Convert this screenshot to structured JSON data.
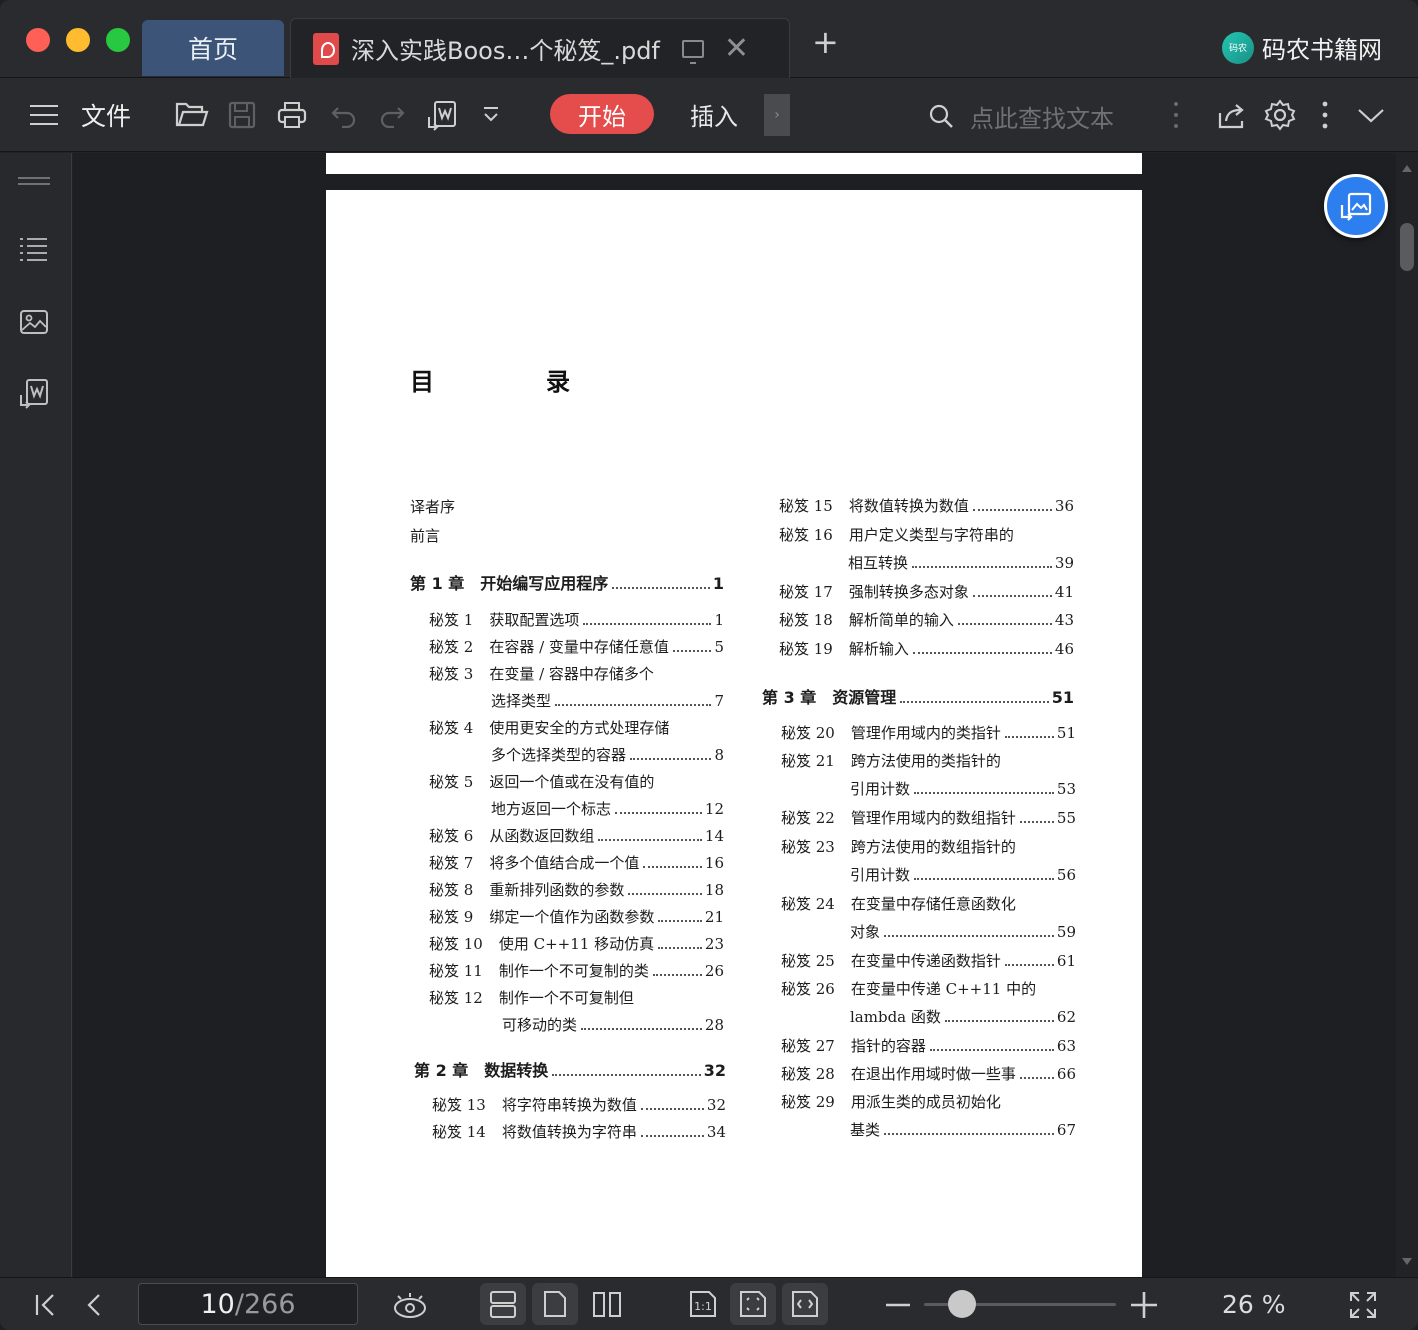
{
  "titlebar": {
    "home_tab": "首页",
    "doc_tab": "深入实践Boos…个秘笈_.pdf",
    "add_tab": "+",
    "close_tab": "✕",
    "brand": "码农书籍网",
    "brand_logo": "码农"
  },
  "toolbar": {
    "file_label": "文件",
    "start_label": "开始",
    "insert_label": "插入",
    "more_label": "›",
    "search_placeholder": "点此查找文本",
    "accent": "#e54c4c"
  },
  "toc": {
    "title": "目　录",
    "left": [
      {
        "label": "",
        "text": "译者序",
        "page": ""
      },
      {
        "label": "",
        "text": "前言",
        "page": ""
      },
      {
        "label": "第 1 章",
        "text": "开始编写应用程序",
        "page": "1",
        "chapter": true
      },
      {
        "label": "秘笈 1",
        "text": "获取配置选项",
        "page": "1"
      },
      {
        "label": "秘笈 2",
        "text": "在容器 / 变量中存储任意值",
        "page": "5"
      },
      {
        "label": "秘笈 3",
        "text": "在变量 / 容器中存储多个",
        "page": ""
      },
      {
        "label": "",
        "text": "选择类型",
        "page": "7"
      },
      {
        "label": "秘笈 4",
        "text": "使用更安全的方式处理存储",
        "page": ""
      },
      {
        "label": "",
        "text": "多个选择类型的容器",
        "page": "8"
      },
      {
        "label": "秘笈 5",
        "text": "返回一个值或在没有值的",
        "page": ""
      },
      {
        "label": "",
        "text": "地方返回一个标志",
        "page": "12"
      },
      {
        "label": "秘笈 6",
        "text": "从函数返回数组",
        "page": "14"
      },
      {
        "label": "秘笈 7",
        "text": "将多个值结合成一个值",
        "page": "16"
      },
      {
        "label": "秘笈 8",
        "text": "重新排列函数的参数",
        "page": "18"
      },
      {
        "label": "秘笈 9",
        "text": "绑定一个值作为函数参数",
        "page": "21"
      },
      {
        "label": "秘笈 10",
        "text": "使用 C++11 移动仿真",
        "page": "23"
      },
      {
        "label": "秘笈 11",
        "text": "制作一个不可复制的类",
        "page": "26"
      },
      {
        "label": "秘笈 12",
        "text": "制作一个不可复制但",
        "page": ""
      },
      {
        "label": "",
        "text": "可移动的类",
        "page": "28"
      },
      {
        "label": "第 2 章",
        "text": "数据转换",
        "page": "32",
        "chapter": true
      },
      {
        "label": "秘笈 13",
        "text": "将字符串转换为数值",
        "page": "32"
      },
      {
        "label": "秘笈 14",
        "text": "将数值转换为字符串",
        "page": "34"
      }
    ],
    "right": [
      {
        "label": "秘笈 15",
        "text": "将数值转换为数值",
        "page": "36"
      },
      {
        "label": "秘笈 16",
        "text": "用户定义类型与字符串的",
        "page": ""
      },
      {
        "label": "",
        "text": "相互转换",
        "page": "39"
      },
      {
        "label": "秘笈 17",
        "text": "强制转换多态对象",
        "page": "41"
      },
      {
        "label": "秘笈 18",
        "text": "解析简单的输入",
        "page": "43"
      },
      {
        "label": "秘笈 19",
        "text": "解析输入",
        "page": "46"
      },
      {
        "label": "第 3 章",
        "text": "资源管理",
        "page": "51",
        "chapter": true
      },
      {
        "label": "秘笈 20",
        "text": "管理作用域内的类指针",
        "page": "51"
      },
      {
        "label": "秘笈 21",
        "text": "跨方法使用的类指针的",
        "page": ""
      },
      {
        "label": "",
        "text": "引用计数",
        "page": "53"
      },
      {
        "label": "秘笈 22",
        "text": "管理作用域内的数组指针",
        "page": "55"
      },
      {
        "label": "秘笈 23",
        "text": "跨方法使用的数组指针的",
        "page": ""
      },
      {
        "label": "",
        "text": "引用计数",
        "page": "56"
      },
      {
        "label": "秘笈 24",
        "text": "在变量中存储任意函数化",
        "page": ""
      },
      {
        "label": "",
        "text": "对象",
        "page": "59"
      },
      {
        "label": "秘笈 25",
        "text": "在变量中传递函数指针",
        "page": "61"
      },
      {
        "label": "秘笈 26",
        "text": "在变量中传递 C++11 中的",
        "page": ""
      },
      {
        "label": "",
        "text": "lambda 函数",
        "page": "62"
      },
      {
        "label": "秘笈 27",
        "text": "指针的容器",
        "page": "63"
      },
      {
        "label": "秘笈 28",
        "text": "在退出作用域时做一些事",
        "page": "66"
      },
      {
        "label": "秘笈 29",
        "text": "用派生类的成员初始化",
        "page": ""
      },
      {
        "label": "",
        "text": "基类",
        "page": "67"
      }
    ]
  },
  "statusbar": {
    "page_current": "10",
    "page_total": "/266",
    "zoom": "26 %",
    "zoom_fraction": 0.26
  },
  "colors": {
    "home_tab": "#3b5478",
    "float_button": "#2d7ff0"
  }
}
